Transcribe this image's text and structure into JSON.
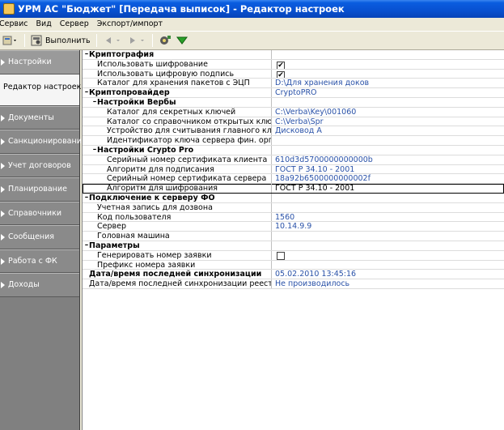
{
  "window": {
    "title": "УРМ АС \"Бюджет\" [Передача выписок] - Редактор настроек"
  },
  "menu": [
    "Сервис",
    "Вид",
    "Сервер",
    "Экспорт/импорт"
  ],
  "toolbar": {
    "execute_label": "Выполнить"
  },
  "sidebar": {
    "items": [
      {
        "label": "Настройки",
        "selected": false,
        "arrow": true
      },
      {
        "label": "Редактор настроек",
        "selected": true,
        "arrow": false
      },
      {
        "label": "Документы",
        "selected": false,
        "arrow": true
      },
      {
        "label": "Санкционирование",
        "selected": false,
        "arrow": true
      },
      {
        "label": "Учет договоров",
        "selected": false,
        "arrow": true
      },
      {
        "label": "Планирование",
        "selected": false,
        "arrow": true
      },
      {
        "label": "Справочники",
        "selected": false,
        "arrow": true
      },
      {
        "label": "Сообщения",
        "selected": false,
        "arrow": true
      },
      {
        "label": "Работа с ФК",
        "selected": false,
        "arrow": true
      },
      {
        "label": "Доходы",
        "selected": false,
        "arrow": true
      }
    ]
  },
  "grid": {
    "rows": [
      {
        "label": "Криптография",
        "value": "",
        "type": "cat",
        "level": 0
      },
      {
        "label": "Использовать шифрование",
        "value": "✔",
        "type": "check",
        "level": 1
      },
      {
        "label": "Использовать цифровую подпись",
        "value": "✔",
        "type": "check",
        "level": 1
      },
      {
        "label": "Каталог для хранения пакетов с ЭЦП",
        "value": "D:\\Для хранения доков",
        "type": "value",
        "level": 1
      },
      {
        "label": "Криптопровайдер",
        "value": "CryptoPRO",
        "type": "cat",
        "level": 0
      },
      {
        "label": "Настройки Вербы",
        "value": "",
        "type": "cat",
        "level": 1
      },
      {
        "label": "Каталог для секретных ключей",
        "value": "C:\\Verba\\Key\\001060",
        "type": "value",
        "level": 2
      },
      {
        "label": "Каталог со справочником открытых ключей",
        "value": "C:\\Verba\\Spr",
        "type": "value",
        "level": 2
      },
      {
        "label": "Устройство для считывания главного ключа",
        "value": "Дисковод A",
        "type": "value",
        "level": 2
      },
      {
        "label": "Идентификатор ключа сервера фин. органа",
        "value": "",
        "type": "value",
        "level": 2
      },
      {
        "label": "Настройки Crypto Pro",
        "value": "",
        "type": "cat",
        "level": 1
      },
      {
        "label": "Серийный номер сертификата клиента",
        "value": "610d3d5700000000000b",
        "type": "value",
        "level": 2
      },
      {
        "label": "Алгоритм для подписания",
        "value": "ГОСТ Р 34.10 - 2001",
        "type": "value",
        "level": 2
      },
      {
        "label": "Серийный номер сертификата сервера",
        "value": "18a92b6500000000002f",
        "type": "value",
        "level": 2
      },
      {
        "label": "Алгоритм для шифрования",
        "value": "ГОСТ Р 34.10 - 2001",
        "type": "selected",
        "level": 2
      },
      {
        "label": "Подключение к серверу ФО",
        "value": "",
        "type": "cat",
        "level": 0
      },
      {
        "label": "Учетная запись для дозвона",
        "value": "",
        "type": "value",
        "level": 1
      },
      {
        "label": "Код пользователя",
        "value": "1560",
        "type": "value",
        "level": 1
      },
      {
        "label": "Сервер",
        "value": "10.14.9.9",
        "type": "value",
        "level": 1
      },
      {
        "label": "Головная машина",
        "value": "",
        "type": "value",
        "level": 1
      },
      {
        "label": "Параметры",
        "value": "",
        "type": "cat",
        "level": 0
      },
      {
        "label": "Генерировать номер заявки",
        "value": "",
        "type": "check",
        "level": 1
      },
      {
        "label": "Префикс номера заявки",
        "value": "",
        "type": "value",
        "level": 1
      },
      {
        "label": "Дата/время последней синхронизации",
        "value": "05.02.2010 13:45:16",
        "type": "bold",
        "level": 0
      },
      {
        "label": "Дата/время последней синхронизации реестра",
        "value": "Не производилось",
        "type": "value",
        "level": 0
      }
    ]
  },
  "colors": {
    "titlebar": "#0850d0",
    "value_text": "#2a52a8",
    "sidebar": "#808080"
  }
}
